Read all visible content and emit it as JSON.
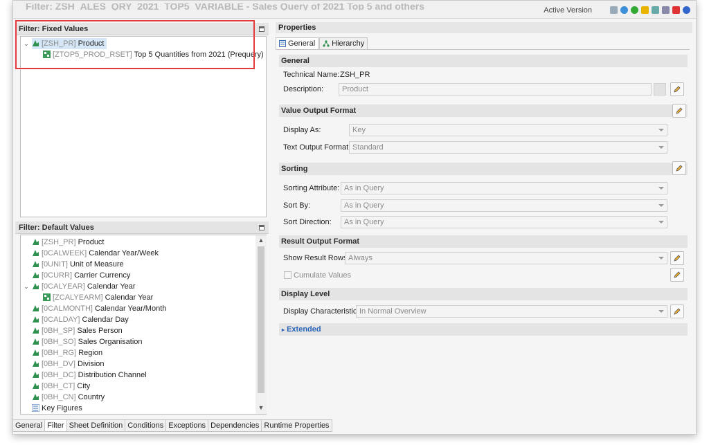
{
  "window": {
    "title": "Filter: ZSH_ALES_QRY_2021_TOP5_VARIABLE - Sales Query of 2021 Top 5 and others",
    "version_label": "Active Version"
  },
  "fixed_values": {
    "title": "Filter: Fixed Values",
    "items": [
      {
        "key": "[ZSH_PR]",
        "name": "Product"
      },
      {
        "key": "[ZTOP5_PROD_RSET]",
        "name": "Top 5 Quantities from 2021 (Prequery)"
      }
    ]
  },
  "default_values": {
    "title": "Filter: Default Values",
    "items": [
      {
        "key": "[ZSH_PR]",
        "name": "Product"
      },
      {
        "key": "[0CALWEEK]",
        "name": "Calendar Year/Week"
      },
      {
        "key": "[0UNIT]",
        "name": "Unit of Measure"
      },
      {
        "key": "[0CURR]",
        "name": "Carrier Currency"
      },
      {
        "key": "[0CALYEAR]",
        "name": "Calendar Year"
      },
      {
        "key": "[ZCALYEARM]",
        "name": "Calendar Year"
      },
      {
        "key": "[0CALMONTH]",
        "name": "Calendar Year/Month"
      },
      {
        "key": "[0CALDAY]",
        "name": "Calendar Day"
      },
      {
        "key": "[0BH_SP]",
        "name": "Sales Person"
      },
      {
        "key": "[0BH_SO]",
        "name": "Sales Organisation"
      },
      {
        "key": "[0BH_RG]",
        "name": "Region"
      },
      {
        "key": "[0BH_DV]",
        "name": "Division"
      },
      {
        "key": "[0BH_DC]",
        "name": "Distribution Channel"
      },
      {
        "key": "[0BH_CT]",
        "name": "City"
      },
      {
        "key": "[0BH_CN]",
        "name": "Country"
      },
      {
        "key": "",
        "name": "Key Figures"
      }
    ]
  },
  "properties": {
    "title": "Properties",
    "tabs": [
      "General",
      "Hierarchy"
    ],
    "general": {
      "section": "General",
      "technical_name_label": "Technical Name:",
      "technical_name": "ZSH_PR",
      "description_label": "Description:",
      "description": "Product"
    },
    "value_output": {
      "section": "Value Output Format",
      "display_as_label": "Display As:",
      "display_as": "Key",
      "text_output_label": "Text Output Format:",
      "text_output": "Standard"
    },
    "sorting": {
      "section": "Sorting",
      "attribute_label": "Sorting Attribute:",
      "attribute": "As in Query",
      "sort_by_label": "Sort By:",
      "sort_by": "As in Query",
      "direction_label": "Sort Direction:",
      "direction": "As in Query"
    },
    "result_output": {
      "section": "Result Output Format",
      "show_rows_label": "Show Result Rows:",
      "show_rows": "Always",
      "cumulate_label": "Cumulate Values"
    },
    "display_level": {
      "section": "Display Level",
      "characteristic_label": "Display Characteristic:",
      "characteristic": "In Normal Overview"
    },
    "extended": "Extended"
  },
  "bottom_tabs": [
    "General",
    "Filter",
    "Sheet Definition",
    "Conditions",
    "Exceptions",
    "Dependencies",
    "Runtime Properties"
  ],
  "colors": {
    "highlight_border": "#e33a3a",
    "selection": "#d6e8f7",
    "link": "#2a62b8"
  }
}
